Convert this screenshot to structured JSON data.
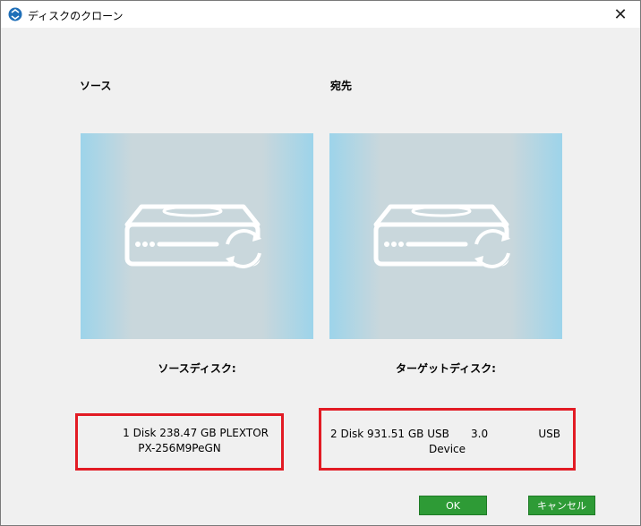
{
  "window": {
    "title": "ディスクのクローン",
    "close_glyph": "✕"
  },
  "source": {
    "label": "ソース",
    "caption": "ソースディスク:",
    "disk_line1": "1 Disk 238.47 GB PLEXTOR",
    "disk_line2": "PX-256M9PeGN"
  },
  "destination": {
    "label": "宛先",
    "caption": "ターゲットディスク:",
    "disk_part1": "2 Disk 931.51 GB USB",
    "disk_part2": "3.0",
    "disk_part3": "USB",
    "disk_line2": "Device"
  },
  "buttons": {
    "ok": "OK",
    "cancel": "キャンセル"
  },
  "colors": {
    "accent_green": "#2e9b36",
    "highlight_red": "#e21b24",
    "panel_blue": "#9dd4ea"
  }
}
